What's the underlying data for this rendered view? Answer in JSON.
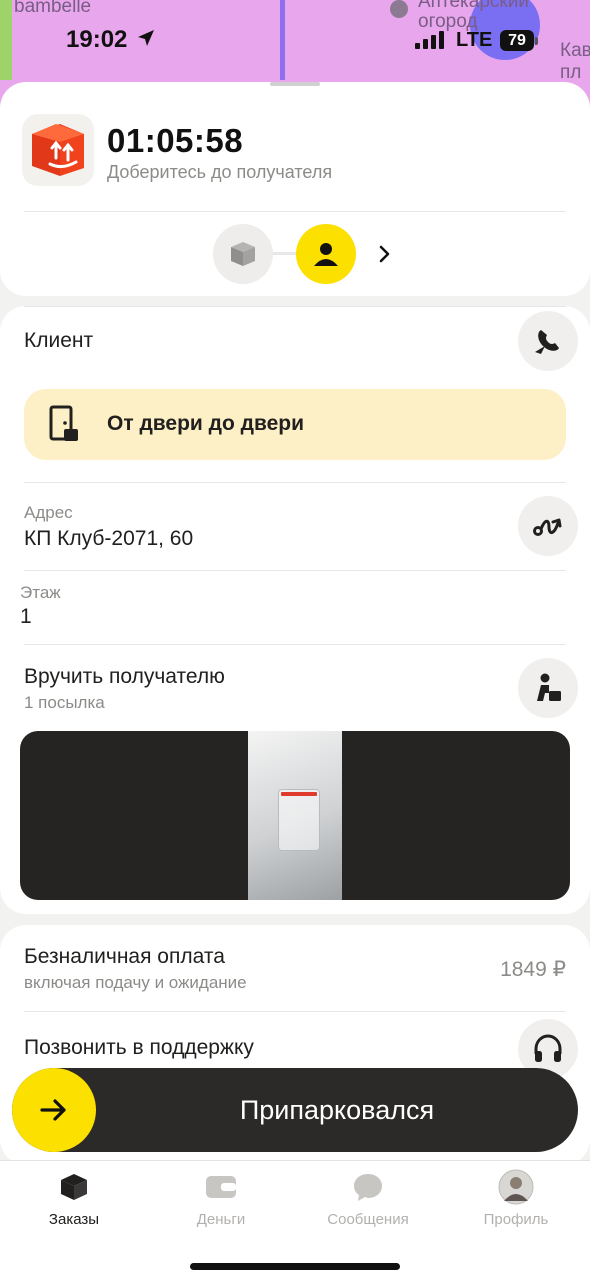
{
  "status_bar": {
    "time": "19:02",
    "network": "LTE",
    "battery": "79"
  },
  "map": {
    "labels": [
      "bambelle",
      "Аптекарский огород",
      "Кав пл"
    ]
  },
  "header": {
    "timer": "01:05:58",
    "subtitle": "Доберитесь до получателя",
    "steps": [
      "parcel-icon",
      "client-icon"
    ]
  },
  "details": {
    "client_label": "Клиент",
    "delivery_type": "От двери до двери",
    "address_label": "Адрес",
    "address_value": "КП Клуб-2071, 60",
    "floor_label": "Этаж",
    "floor_value": "1",
    "handover_title": "Вручить получателю",
    "handover_count": "1 посылка"
  },
  "payment": {
    "title": "Безналичная оплата",
    "subtitle": "включая подачу и ожидание",
    "amount": "1849 ₽",
    "support_label": "Позвонить в поддержку"
  },
  "action": {
    "slider_label": "Припарковался"
  },
  "tabs": [
    {
      "label": "Заказы",
      "icon": "orders-icon",
      "active": true
    },
    {
      "label": "Деньги",
      "icon": "wallet-icon",
      "active": false
    },
    {
      "label": "Сообщения",
      "icon": "chat-icon",
      "active": false
    },
    {
      "label": "Профиль",
      "icon": "avatar",
      "active": false
    }
  ],
  "colors": {
    "accent_yellow": "#fce000",
    "banner_bg": "#fdefc6",
    "logo_red": "#f0421c",
    "map_bg": "#e8a6ec"
  }
}
